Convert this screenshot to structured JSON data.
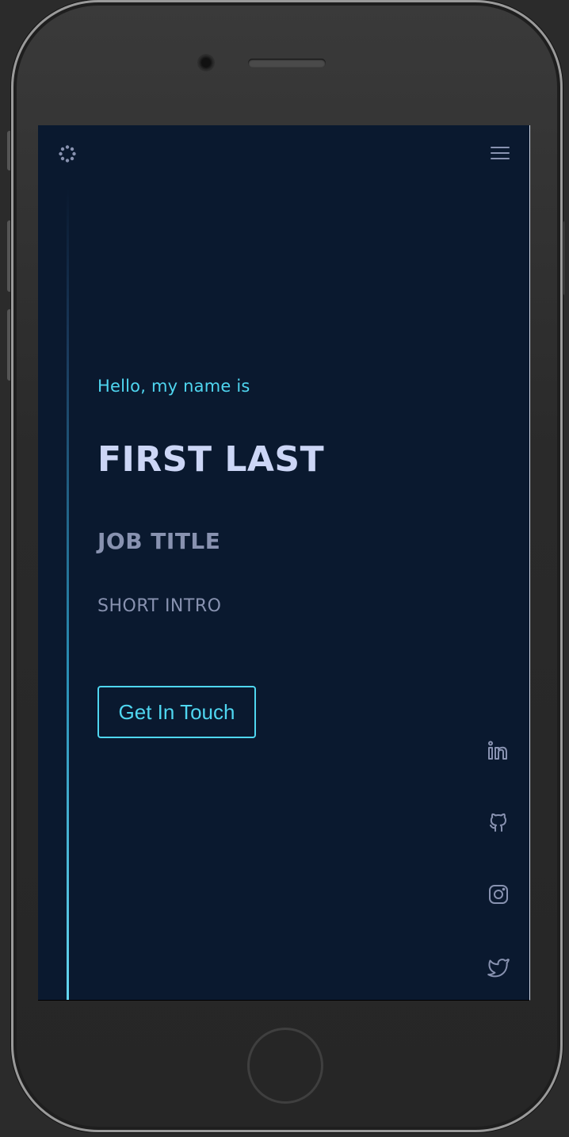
{
  "colors": {
    "background": "#0a192f",
    "accent": "#4fd6f0",
    "heading": "#ccd6f6",
    "muted": "#8892b0"
  },
  "nav": {
    "logo_icon": "logo-icon",
    "menu_icon": "hamburger-menu-icon"
  },
  "hero": {
    "greeting": "Hello, my name is",
    "name": "FIRST LAST",
    "job_title": "JOB TITLE",
    "intro": "SHORT INTRO",
    "cta_label": "Get In Touch"
  },
  "social": [
    {
      "icon": "linkedin-icon"
    },
    {
      "icon": "github-icon"
    },
    {
      "icon": "instagram-icon"
    },
    {
      "icon": "twitter-icon"
    }
  ]
}
